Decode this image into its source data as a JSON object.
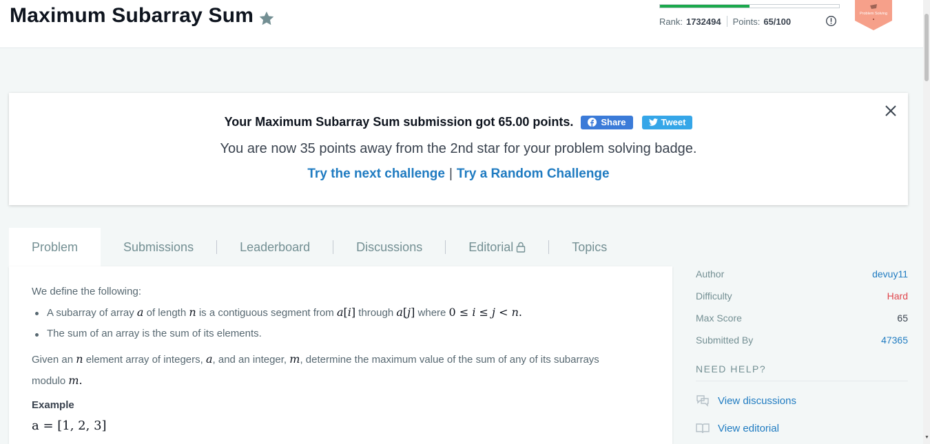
{
  "header": {
    "title": "Maximum Subarray Sum",
    "rank_label": "Rank:",
    "rank_value": "1732494",
    "points_label": "Points:",
    "points_value": "65/100",
    "points_progress": 0.5,
    "badge_label": "Problem Solving"
  },
  "banner": {
    "message": "Your Maximum Subarray Sum submission got 65.00 points.",
    "share_label": "Share",
    "tweet_label": "Tweet",
    "subtext": "You are now 35 points away from the 2nd star for your problem solving badge.",
    "next_challenge": "Try the next challenge",
    "separator": "|",
    "random_challenge": "Try a Random Challenge"
  },
  "tabs": [
    "Problem",
    "Submissions",
    "Leaderboard",
    "Discussions",
    "Editorial",
    "Topics"
  ],
  "problem": {
    "intro": "We define the following:",
    "bullet1_a": "A subarray of array",
    "bullet1_b": "of length",
    "bullet1_c": "is a contiguous segment from",
    "bullet1_d": "through",
    "bullet1_e": "where",
    "bullet2": "The sum of an array is the sum of its elements.",
    "given_a": "Given an",
    "given_b": "element array of integers,",
    "given_c": ", and an integer,",
    "given_d": ", determine the maximum value of the sum of any of its subarrays",
    "given_e": "modulo",
    "example_heading": "Example",
    "example_eq": "a = [1, 2, 3]"
  },
  "sidebar": {
    "author_label": "Author",
    "author_value": "devuy11",
    "difficulty_label": "Difficulty",
    "difficulty_value": "Hard",
    "maxscore_label": "Max Score",
    "maxscore_value": "65",
    "submitted_label": "Submitted By",
    "submitted_value": "47365",
    "need_help": "NEED HELP?",
    "view_discussions": "View discussions",
    "view_editorial": "View editorial"
  },
  "colors": {
    "accent_blue": "#1f7bc1",
    "progress_green": "#1ba94c",
    "difficulty_red": "#e0464c",
    "badge_salmon": "#f6a08a"
  }
}
